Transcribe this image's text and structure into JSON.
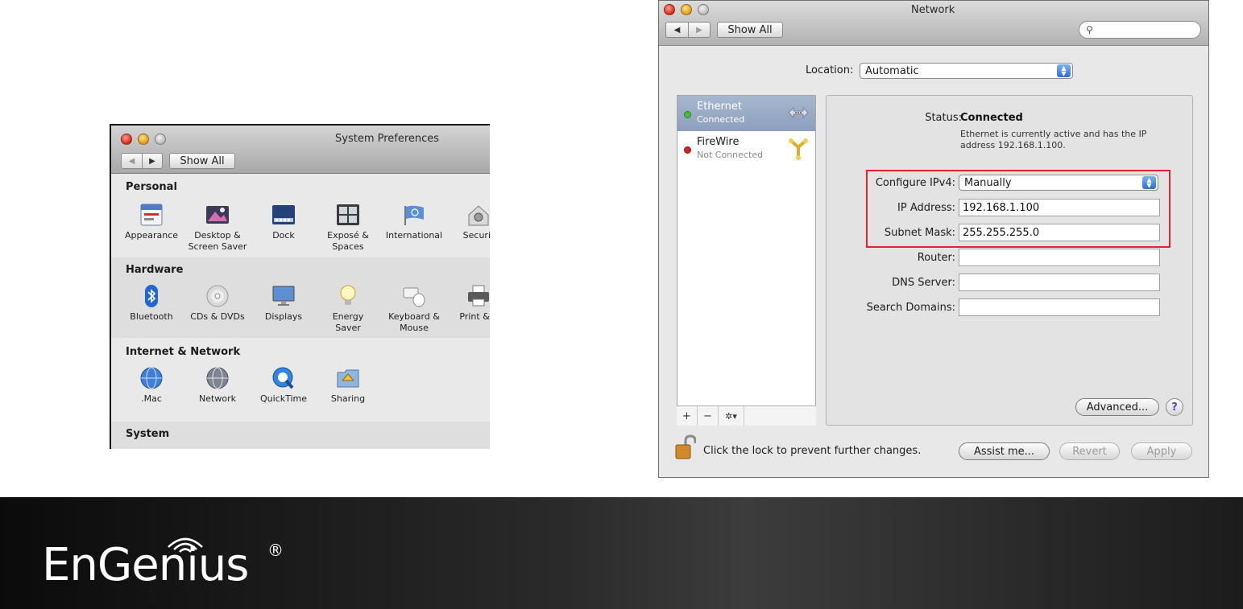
{
  "sysprefs": {
    "title": "System Preferences",
    "show_all": "Show All",
    "nav_back": "◀",
    "nav_forward": "▶",
    "sections": [
      {
        "label": "Personal",
        "items": [
          "Appearance",
          "Desktop &\nScreen Saver",
          "Dock",
          "Exposé &\nSpaces",
          "International",
          "Securit"
        ]
      },
      {
        "label": "Hardware",
        "items": [
          "Bluetooth",
          "CDs & DVDs",
          "Displays",
          "Energy\nSaver",
          "Keyboard &\nMouse",
          "Print & F"
        ]
      },
      {
        "label": "Internet & Network",
        "items": [
          ".Mac",
          "Network",
          "QuickTime",
          "Sharing"
        ]
      },
      {
        "label": "System",
        "items": []
      }
    ]
  },
  "network": {
    "title": "Network",
    "show_all": "Show All",
    "nav_back": "◀",
    "nav_forward": "▶",
    "search_placeholder": "",
    "location_label": "Location:",
    "location_value": "Automatic",
    "services": [
      {
        "name": "Ethernet",
        "status": "Connected",
        "dot_color": "#4cbb3a",
        "selected": true,
        "icon": "ethernet-arrows-icon"
      },
      {
        "name": "FireWire",
        "status": "Not Connected",
        "dot_color": "#d8201d",
        "selected": false,
        "icon": "firewire-icon"
      }
    ],
    "list_tools": {
      "add": "+",
      "remove": "−",
      "gear": "✲▾"
    },
    "status_label": "Status:",
    "status_value": "Connected",
    "status_desc": "Ethernet is currently active and has the IP address 192.168.1.100.",
    "configure_label": "Configure IPv4:",
    "configure_value": "Manually",
    "ip_label": "IP Address:",
    "ip_value": "192.168.1.100",
    "subnet_label": "Subnet Mask:",
    "subnet_value": "255.255.255.0",
    "router_label": "Router:",
    "router_value": "",
    "dns_label": "DNS Server:",
    "dns_value": "",
    "search_domains_label": "Search Domains:",
    "search_domains_value": "",
    "advanced_button": "Advanced...",
    "help_button": "?",
    "lock_text": "Click the lock to prevent further changes.",
    "assist_button": "Assist me...",
    "revert_button": "Revert",
    "apply_button": "Apply",
    "highlight_color": "#e0262c"
  },
  "footer": {
    "logo_text": "EnGenius",
    "logo_reg": "®"
  }
}
